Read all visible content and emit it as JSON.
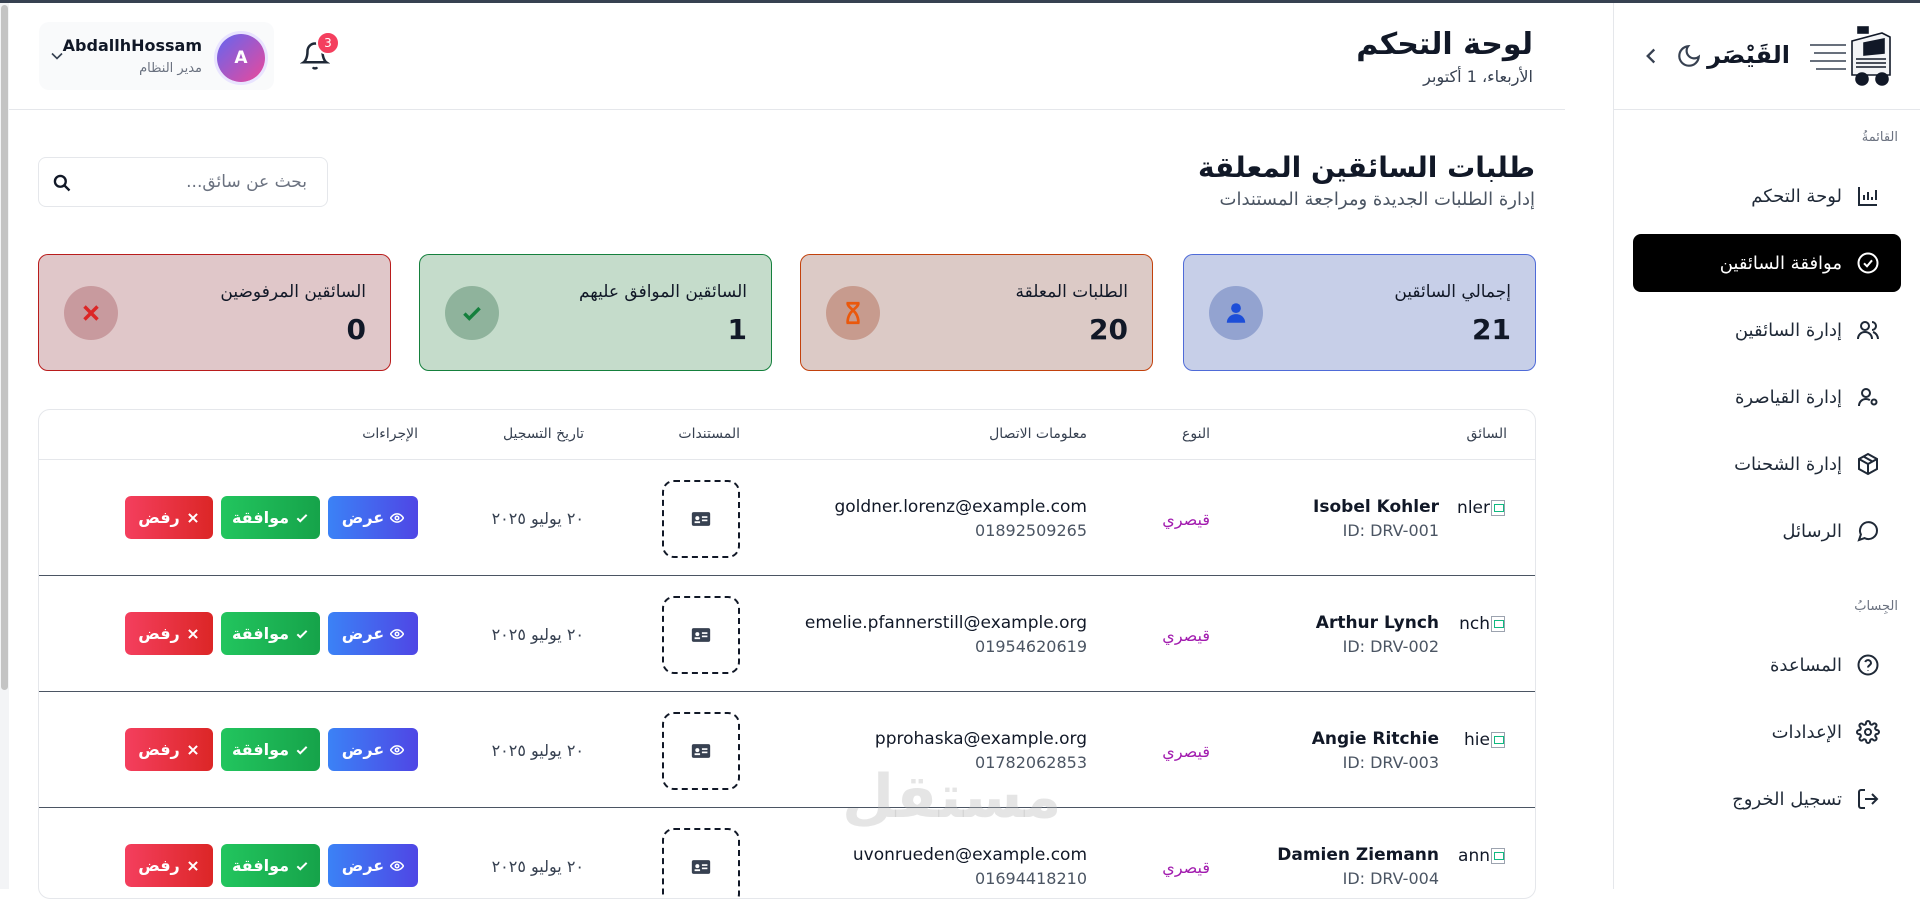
{
  "sidebar": {
    "brand": "القَيْصَر",
    "section_menu": "القائمةُ",
    "section_other": "الجِسابُ",
    "items": [
      {
        "label": "لوحة التحكم",
        "icon": "bar-chart-icon"
      },
      {
        "label": "موافقة السائقين",
        "icon": "check-circle-icon",
        "active": true
      },
      {
        "label": "إدارة السائقين",
        "icon": "users-icon"
      },
      {
        "label": "إدارة القياصرة",
        "icon": "user-cog-icon"
      },
      {
        "label": "إدارة الشحنات",
        "icon": "package-icon"
      },
      {
        "label": "الرسائل",
        "icon": "message-icon"
      }
    ],
    "bottom_items": [
      {
        "label": "المساعدة",
        "icon": "help-icon"
      },
      {
        "label": "الإعدادات",
        "icon": "settings-icon"
      },
      {
        "label": "تسجيل الخروج",
        "icon": "logout-icon"
      }
    ]
  },
  "header": {
    "title": "لوحة التحكم",
    "date": "الأربعاء، 1 أكتوبر",
    "notifications_count": "3",
    "user": {
      "name": "AbdallhHossam",
      "role": "مدير النظام",
      "initial": "A"
    }
  },
  "main": {
    "title": "طلبات السائقين المعلقة",
    "subtitle": "إدارة الطلبات الجديدة ومراجعة المستندات",
    "search_placeholder": "بحث عن سائق...",
    "stats": [
      {
        "label": "إجمالي السائقين",
        "value": "21",
        "color": "#c7cfe8"
      },
      {
        "label": "الطلبات المعلقة",
        "value": "20",
        "color": "#dccac6"
      },
      {
        "label": "السائقين الموافق عليهم",
        "value": "1",
        "color": "#c5dccb"
      },
      {
        "label": "السائقين المرفوضين",
        "value": "0",
        "color": "#e0c7c9"
      }
    ],
    "table": {
      "headers": {
        "driver": "السائق",
        "type": "النوع",
        "contact": "معلومات الاتصال",
        "documents": "المستندات",
        "registered": "تاريخ التسجيل",
        "actions": "الإجراءات"
      },
      "actions": {
        "view": "عرض",
        "approve": "موافقة",
        "reject": "رفض"
      },
      "rows": [
        {
          "img_alt": "nler",
          "name": "Isobel Kohler",
          "id": "ID: DRV-001",
          "type": "قيصري",
          "email": "goldner.lorenz@example.com",
          "phone": "01892509265",
          "date": "٢٠ يوليو ٢٠٢٥"
        },
        {
          "img_alt": "nch",
          "name": "Arthur Lynch",
          "id": "ID: DRV-002",
          "type": "قيصري",
          "email": "emelie.pfannerstill@example.org",
          "phone": "01954620619",
          "date": "٢٠ يوليو ٢٠٢٥"
        },
        {
          "img_alt": "hie",
          "name": "Angie Ritchie",
          "id": "ID: DRV-003",
          "type": "قيصري",
          "email": "pprohaska@example.org",
          "phone": "01782062853",
          "date": "٢٠ يوليو ٢٠٢٥"
        },
        {
          "img_alt": "ann",
          "name": "Damien Ziemann",
          "id": "ID: DRV-004",
          "type": "قيصري",
          "email": "uvonrueden@example.com",
          "phone": "01694418210",
          "date": "٢٠ يوليو ٢٠٢٥"
        }
      ]
    }
  },
  "watermark": "مستقل"
}
